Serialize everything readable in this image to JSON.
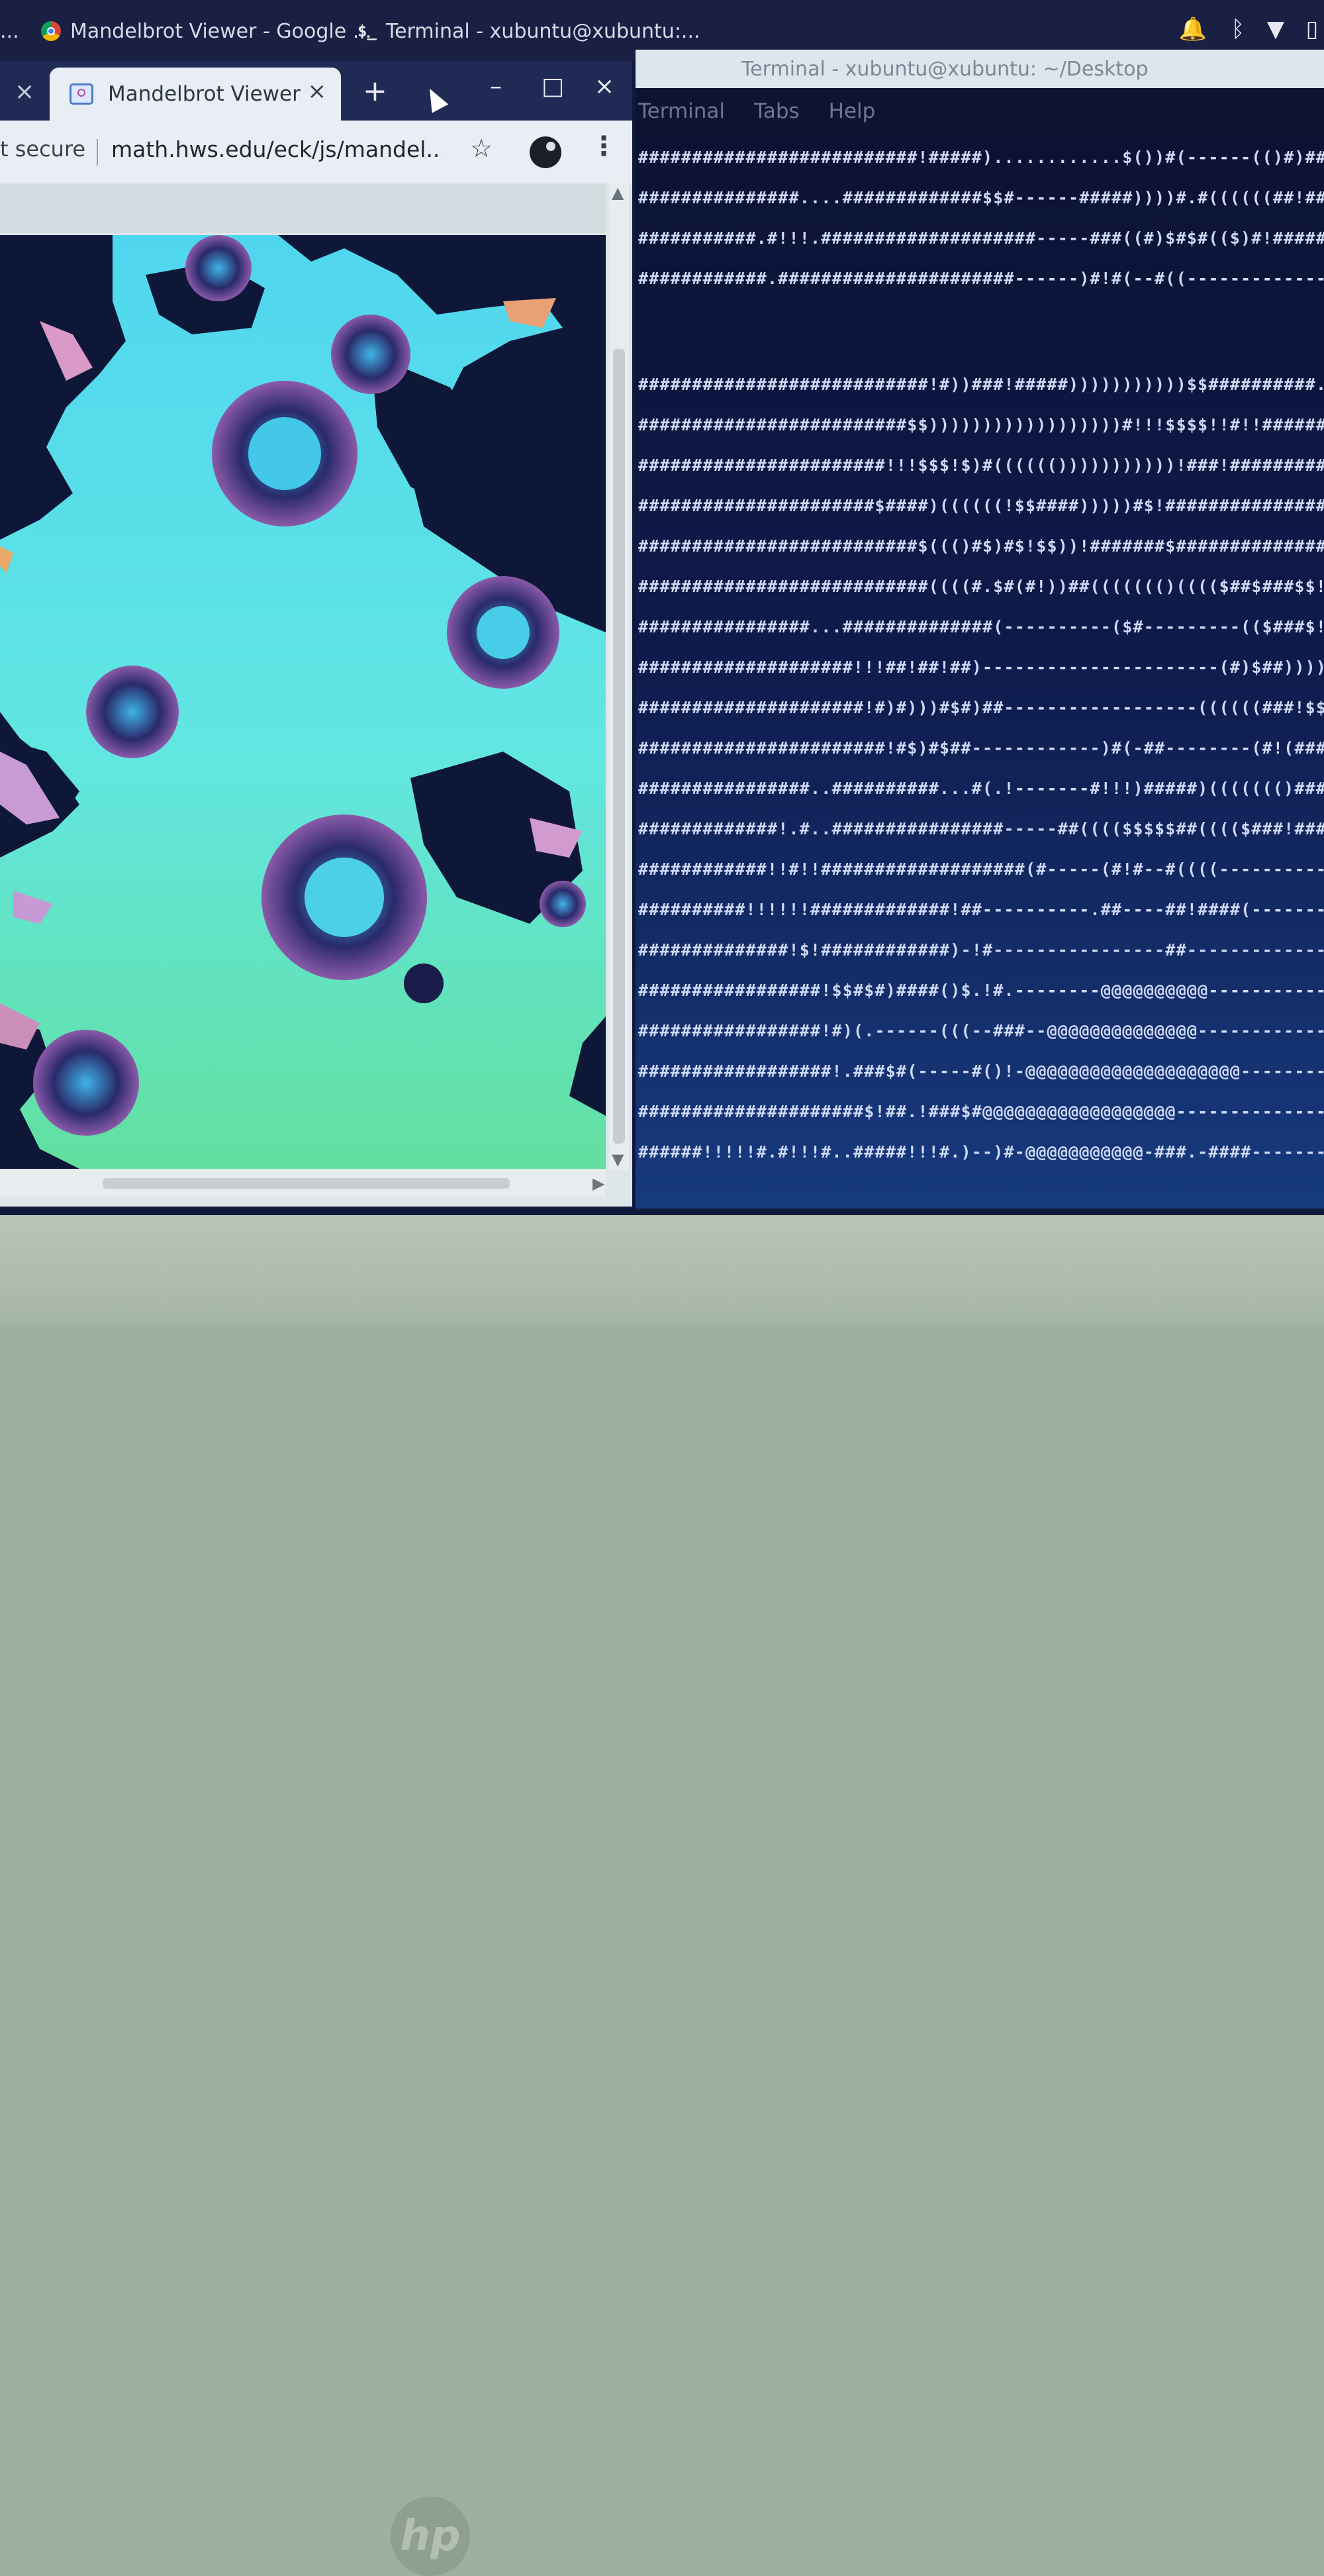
{
  "panel": {
    "tasks": [
      {
        "label": "Mandelbrot Viewer - Google ...",
        "icon": "chrome-icon"
      },
      {
        "label": "Terminal - xubuntu@xubuntu:...",
        "icon": "terminal-icon"
      }
    ],
    "tray": [
      {
        "icon": "bell-icon",
        "glyph": "🔔"
      },
      {
        "icon": "bluetooth-icon",
        "glyph": "ᛒ"
      },
      {
        "icon": "wifi-icon",
        "glyph": "▼"
      },
      {
        "icon": "battery-icon",
        "glyph": "▯"
      }
    ],
    "leading_text": "..."
  },
  "browser": {
    "tab": {
      "title": "Mandelbrot Viewer",
      "close": "×"
    },
    "prev_tab_close": "×",
    "new_tab": "+",
    "window_controls": {
      "minimize": "–",
      "maximize": "□",
      "close": "×"
    },
    "toolbar": {
      "security_label": "t secure",
      "url": "math.hws.edu/eck/js/mandel...",
      "star": "☆",
      "menu": "⋮"
    }
  },
  "terminal": {
    "title": "Terminal - xubuntu@xubuntu: ~/Desktop",
    "menu": [
      "Terminal",
      "Tabs",
      "Help"
    ],
    "lines": [
      "##########################!#####)............$())#(------(()#)#########",
      "###############....#############$$#------#####))))#.#((((((##!##.#######",
      "###########.#!!!.####################-----###((#)$#$#(($)#!########)#)###",
      "############.######################------)#!#(--#((-------------!-)$####",
      "",
      "###########################!#))###!#####)))))))))))$$##########.#######",
      "#########################$$))))))))))))))))))#!!!$$$$!!#!!##########",
      "#######################!!!$$$!$)#(((((()))))))))))!###!################",
      "######################$####)((((((!$$####)))))#$!#####################",
      "##########################$((()#$)#$!$$))!#######$######################",
      "###########################((((#.$#(#!))##((((((()(((($##$###$$!####",
      "################...##############(----------($#---------(($###$!))))))))",
      "####################!!!##!##!##)----------------------(#)$##))))))!#$##",
      "#####################!#)#)))#$#)##------------------((((((###!$$!####",
      "#######################!#$)#$##------------)#(-##--------(#!(###########",
      "################..##########...#(.!-------#!!!)#####)((((((()#######.####",
      "#############!.#..################-----##(((($$$$$##(((($###!####.######",
      "############!!#!!###################(#-----(#!#--#((((-------------()((####",
      "##########!!!!!!#############!##----------.##----##!####(---------------",
      "##############!$!############)-!#----------------##---------------#)",
      "#################!$$#$#)####()$.!#.--------@@@@@@@@@@---------------##-",
      "#################!#)(.------(((--###--@@@@@@@@@@@@@@-------------(#)",
      "##################!.###$#(-----#()!-@@@@@@@@@@@@@@@@@@@@---------------)!",
      "#####################$!##.!###$#@@@@@@@@@@@@@@@@@@--------------------",
      "######!!!!!#.#!!!#..#####!!!#.)--)#-@@@@@@@@@@@-###.-####---------------"
    ]
  }
}
